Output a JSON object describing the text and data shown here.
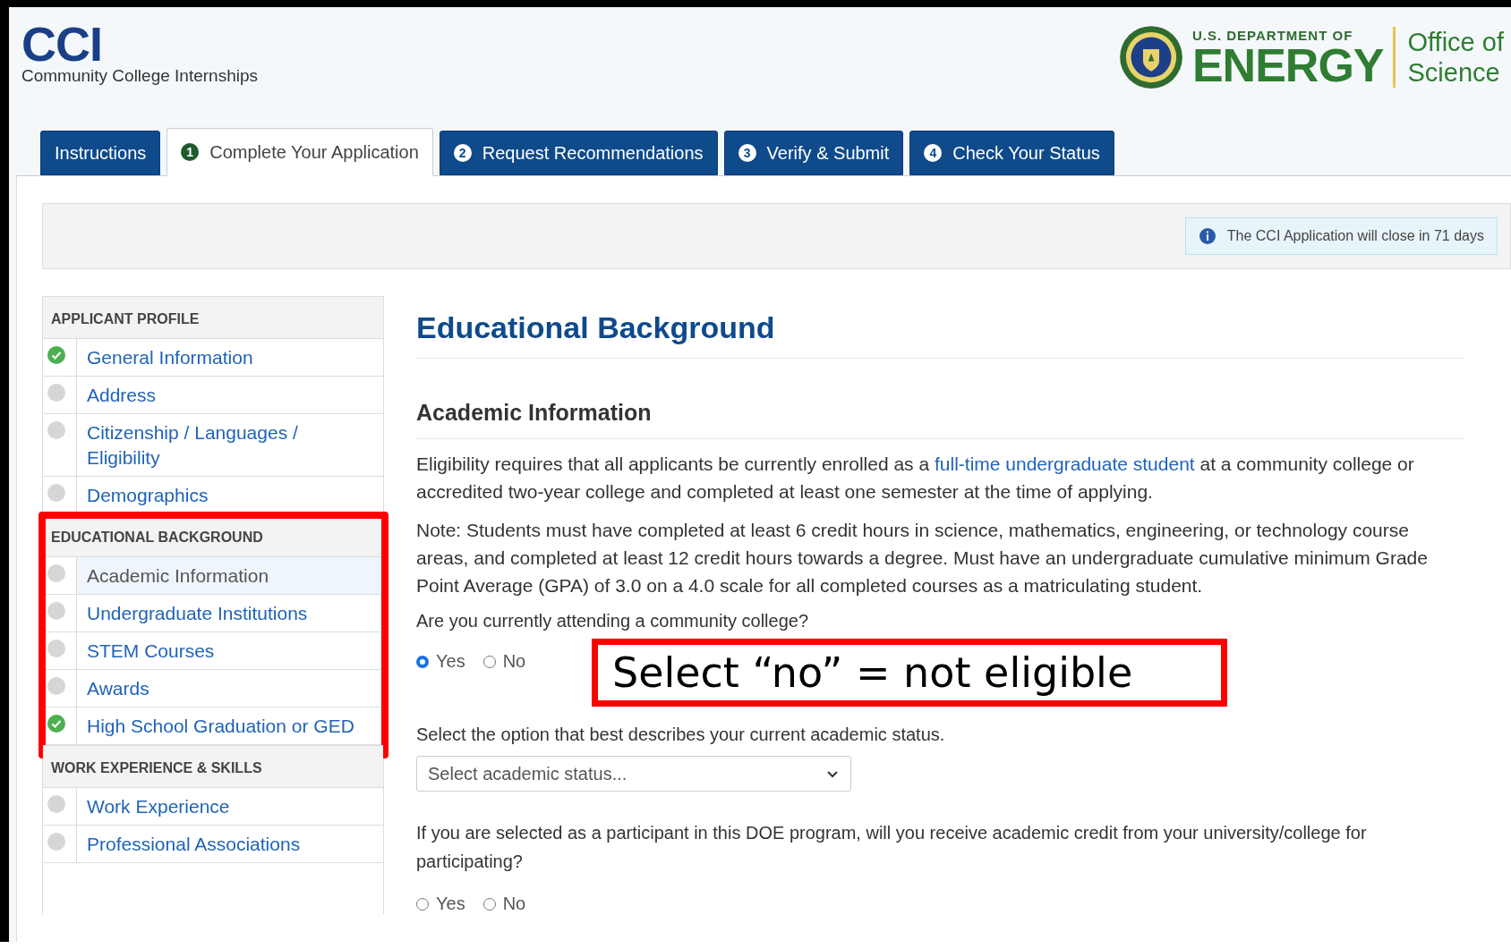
{
  "brand": {
    "logo": "CCI",
    "subtitle": "Community College Internships"
  },
  "agency": {
    "department": "U.S. DEPARTMENT OF",
    "name": "ENERGY",
    "office": [
      "Office of",
      "Science"
    ]
  },
  "tabs": [
    {
      "label": "Instructions",
      "selected": false
    },
    {
      "number": "1",
      "label": "Complete Your Application",
      "selected": true
    },
    {
      "number": "2",
      "label": "Request Recommendations",
      "selected": false
    },
    {
      "number": "3",
      "label": "Verify & Submit",
      "selected": false
    },
    {
      "number": "4",
      "label": "Check Your Status",
      "selected": false
    }
  ],
  "notice": "The CCI Application will close in 71 days",
  "sidebar": {
    "sections": [
      {
        "title": "APPLICANT PROFILE",
        "highlighted": false,
        "items": [
          {
            "label": "General Information",
            "complete": true,
            "selected": false
          },
          {
            "label": "Address",
            "complete": false,
            "selected": false
          },
          {
            "label": "Citizenship / Languages / Eligibility",
            "complete": false,
            "selected": false
          },
          {
            "label": "Demographics",
            "complete": false,
            "selected": false
          }
        ]
      },
      {
        "title": "EDUCATIONAL BACKGROUND",
        "highlighted": true,
        "items": [
          {
            "label": "Academic Information",
            "complete": false,
            "selected": true
          },
          {
            "label": "Undergraduate Institutions",
            "complete": false,
            "selected": false
          },
          {
            "label": "STEM Courses",
            "complete": false,
            "selected": false
          },
          {
            "label": "Awards",
            "complete": false,
            "selected": false
          },
          {
            "label": "High School Graduation or GED",
            "complete": true,
            "selected": false
          }
        ]
      },
      {
        "title": "WORK EXPERIENCE & SKILLS",
        "highlighted": false,
        "items": [
          {
            "label": "Work Experience",
            "complete": false,
            "selected": false
          },
          {
            "label": "Professional Associations",
            "complete": false,
            "selected": false
          }
        ]
      }
    ]
  },
  "main": {
    "title": "Educational Background",
    "subtitle": "Academic Information",
    "paragraphs": [
      {
        "before": "Eligibility requires that all applicants be currently enrolled as a ",
        "link": "full-time undergraduate student",
        "after": " at a community college or accredited two-year college and completed at least one semester at the time of applying."
      },
      {
        "before": "Note: Students must have completed at least 6 credit hours in science, mathematics, engineering, or technology course areas, and completed at least 12 credit hours towards a degree. Must have an undergraduate cumulative minimum Grade Point Average (GPA) of 3.0 on a 4.0 scale for all completed courses as a matriculating student."
      }
    ],
    "questions": [
      {
        "kind": "radio",
        "text": "Are you currently attending a community college?",
        "options": [
          {
            "label": "Yes",
            "selected": true
          },
          {
            "label": "No",
            "selected": false
          }
        ],
        "callout": "Select “no” = not eligible"
      },
      {
        "kind": "select",
        "text": "Select the option that best describes your current academic status.",
        "placeholder": "Select academic status..."
      },
      {
        "kind": "radio",
        "text": "If you are selected as a participant in this DOE program, will you receive academic credit from your university/college for participating?",
        "options": [
          {
            "label": "Yes",
            "selected": false
          },
          {
            "label": "No",
            "selected": false
          }
        ]
      }
    ]
  }
}
